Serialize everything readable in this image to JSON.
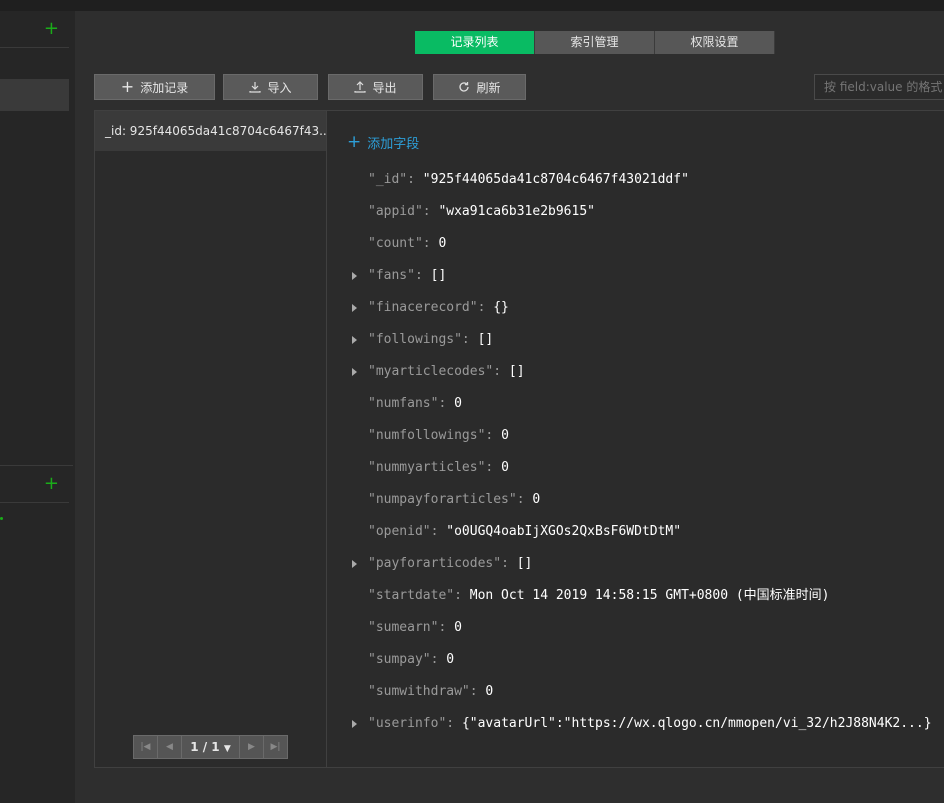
{
  "tabs": [
    {
      "label": "记录列表",
      "active": true
    },
    {
      "label": "索引管理",
      "active": false
    },
    {
      "label": "权限设置",
      "active": false
    }
  ],
  "toolbar": {
    "add_label": "添加记录",
    "import_label": "导入",
    "export_label": "导出",
    "refresh_label": "刷新",
    "search_placeholder": "按 field:value 的格式"
  },
  "records": [
    {
      "label": "_id: 925f44065da41c8704c6467f43..."
    }
  ],
  "pager": {
    "value": "1 / 1"
  },
  "detail": {
    "add_field_label": "添加字段",
    "fields": [
      {
        "key": "\"_id\"",
        "value": "\"925f44065da41c8704c6467f43021ddf\"",
        "expandable": false
      },
      {
        "key": "\"appid\"",
        "value": "\"wxa91ca6b31e2b9615\"",
        "expandable": false
      },
      {
        "key": "\"count\"",
        "value": "0",
        "expandable": false
      },
      {
        "key": "\"fans\"",
        "value": "[]",
        "expandable": true
      },
      {
        "key": "\"finacerecord\"",
        "value": "{}",
        "expandable": true
      },
      {
        "key": "\"followings\"",
        "value": "[]",
        "expandable": true
      },
      {
        "key": "\"myarticlecodes\"",
        "value": "[]",
        "expandable": true
      },
      {
        "key": "\"numfans\"",
        "value": "0",
        "expandable": false
      },
      {
        "key": "\"numfollowings\"",
        "value": "0",
        "expandable": false
      },
      {
        "key": "\"nummyarticles\"",
        "value": "0",
        "expandable": false
      },
      {
        "key": "\"numpayforarticles\"",
        "value": "0",
        "expandable": false
      },
      {
        "key": "\"openid\"",
        "value": "\"o0UGQ4oabIjXGOs2QxBsF6WDtDtM\"",
        "expandable": false
      },
      {
        "key": "\"payforarticodes\"",
        "value": "[]",
        "expandable": true
      },
      {
        "key": "\"startdate\"",
        "value": "Mon Oct 14 2019 14:58:15 GMT+0800 (中国标准时间)",
        "expandable": false
      },
      {
        "key": "\"sumearn\"",
        "value": "0",
        "expandable": false
      },
      {
        "key": "\"sumpay\"",
        "value": "0",
        "expandable": false
      },
      {
        "key": "\"sumwithdraw\"",
        "value": "0",
        "expandable": false
      },
      {
        "key": "\"userinfo\"",
        "value": "{\"avatarUrl\":\"https://wx.qlogo.cn/mmopen/vi_32/h2J88N4K2...}",
        "expandable": true
      }
    ]
  },
  "colors": {
    "accent": "#09bb63",
    "link": "#2d9fd8"
  }
}
